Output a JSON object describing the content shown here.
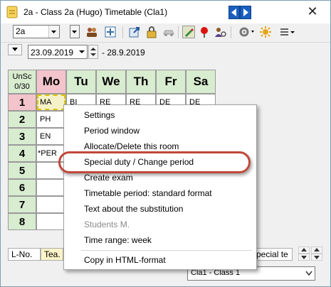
{
  "window": {
    "title": "2a - Class 2a (Hugo)  Timetable  (Cla1)",
    "close_symbol": "✕"
  },
  "toolbar": {
    "class_select": "2a",
    "icons": [
      "people-icon",
      "grid-plus-icon",
      "export-icon",
      "lock-icon",
      "car-icon",
      "pencil-icon",
      "pin-icon",
      "user-settings-icon",
      "gear-icon",
      "sun-icon",
      "list-menu-icon"
    ]
  },
  "datebar": {
    "date_from": "23.09.2019",
    "date_to": "- 28.9.2019"
  },
  "grid": {
    "corner_line1": "UnSc",
    "corner_line2": "0/30",
    "days": [
      "Mo",
      "Tu",
      "We",
      "Th",
      "Fr",
      "Sa"
    ],
    "periods": [
      "1",
      "2",
      "3",
      "4",
      "5",
      "6",
      "7",
      "8"
    ],
    "lessons_mo": [
      "MA",
      "PH",
      "EN",
      "*PER",
      "",
      "",
      "",
      ""
    ],
    "row1": [
      "BI",
      "RE",
      "RE",
      "DE",
      "DE"
    ]
  },
  "status": {
    "cells": [
      "L-No.",
      "Tea.",
      "Special te"
    ]
  },
  "bottom_select": "Cla1 - Class 1",
  "context_menu": {
    "items": [
      {
        "label": "Settings",
        "disabled": false
      },
      {
        "label": "Period window",
        "disabled": false
      },
      {
        "label": "Allocate/Delete this room",
        "disabled": false
      },
      {
        "label": "Special duty / Change period",
        "disabled": false
      },
      {
        "label": "Create exam",
        "disabled": false
      },
      {
        "label": "Timetable period: standard format",
        "disabled": false
      },
      {
        "label": "Text about the substitution",
        "disabled": false
      },
      {
        "label": "Students M.",
        "disabled": true
      },
      {
        "label": "Time range: week",
        "disabled": false
      },
      {
        "label": "Copy in HTML-format",
        "disabled": false
      }
    ]
  },
  "colors": {
    "header_green": "#d8ecd0",
    "header_selected": "#f4c4cc",
    "highlight_ring": "#c0483a",
    "nav_blue": "#1a5fbf"
  }
}
